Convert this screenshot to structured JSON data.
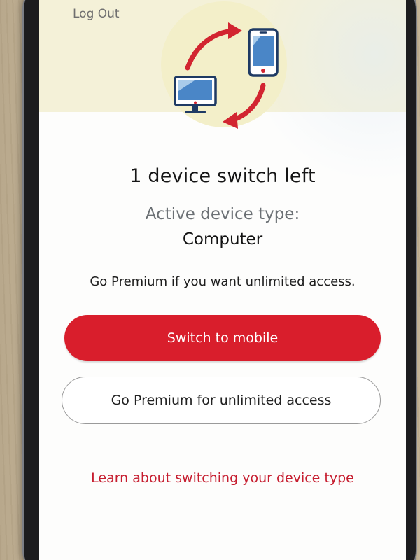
{
  "header": {
    "logout_label": "Log Out"
  },
  "illustration": {
    "icon_names": [
      "computer-icon",
      "mobile-phone-icon",
      "switch-arrows-icon"
    ],
    "circle_color": "#f3efc9",
    "arrow_color": "#d22530",
    "device_color": "#1e3a64"
  },
  "status": {
    "headline": "1 device switch left",
    "active_label": "Active device type:",
    "active_value": "Computer",
    "premium_note": "Go Premium if you want unlimited access."
  },
  "actions": {
    "primary_label": "Switch to mobile",
    "secondary_label": "Go Premium for unlimited access",
    "link_label": "Learn about switching your device type"
  },
  "colors": {
    "accent": "#d91e2c",
    "link": "#c61d2f",
    "top_band": "#f4f1d8"
  }
}
